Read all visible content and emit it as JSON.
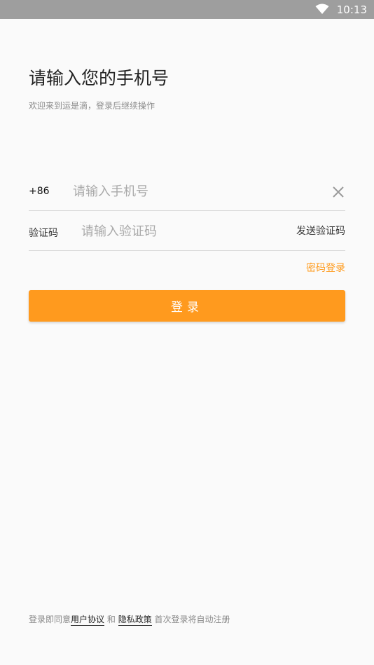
{
  "status_bar": {
    "time": "10:13",
    "icons": [
      "wifi-icon"
    ]
  },
  "header": {
    "title": "请输入您的手机号",
    "subtitle": "欢迎来到运是滴，登录后继续操作"
  },
  "phone_field": {
    "prefix": "+86",
    "placeholder": "请输入手机号",
    "value": "",
    "clear_icon": "close-icon"
  },
  "code_field": {
    "label": "验证码",
    "placeholder": "请输入验证码",
    "value": "",
    "send_label": "发送验证码"
  },
  "password_login_label": "密码登录",
  "login_button_label": "登录",
  "footer": {
    "prefix": "登录即同意",
    "user_agreement": "用户协议",
    "and": "和",
    "privacy_policy": "隐私政策",
    "suffix": "首次登录将自动注册"
  },
  "colors": {
    "accent": "#ff9a1e",
    "status_bar": "#9e9e9e",
    "background": "#fafafa"
  }
}
